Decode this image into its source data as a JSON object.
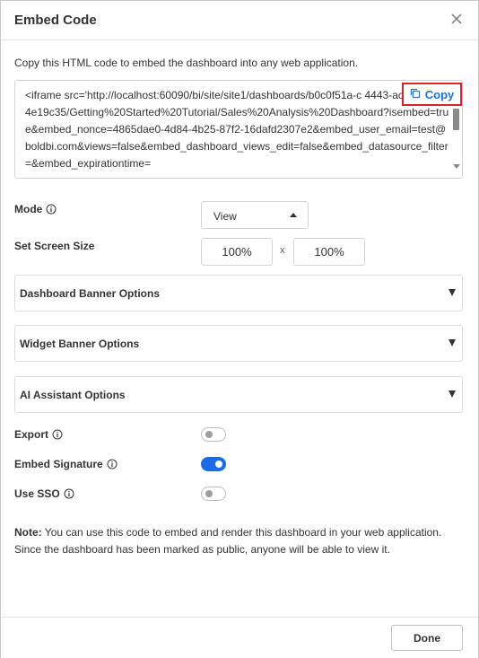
{
  "dialog": {
    "title": "Embed Code",
    "description": "Copy this HTML code to embed the dashboard into any web application.",
    "code": "<iframe src='http://localhost:60090/bi/site/site1/dashboards/b0c0f51a-c 4443-ac6c-874384e19c35/Getting%20Started%20Tutorial/Sales%20Analysis%20Dashboard?isembed=true&embed_nonce=4865dae0-4d84-4b25-87f2-16dafd2307e2&embed_user_email=test@boldbi.com&views=false&embed_dashboard_views_edit=false&embed_datasource_filter=&embed_expirationtime=",
    "copy_label": "Copy"
  },
  "mode": {
    "label": "Mode",
    "value": "View"
  },
  "screen_size": {
    "label": "Set Screen Size",
    "width": "100%",
    "separator": "x",
    "height": "100%"
  },
  "accordions": [
    {
      "label": "Dashboard Banner Options"
    },
    {
      "label": "Widget Banner Options"
    },
    {
      "label": "AI Assistant Options"
    }
  ],
  "toggles": {
    "export": {
      "label": "Export",
      "state": "off"
    },
    "embed_signature": {
      "label": "Embed Signature",
      "state": "on"
    },
    "use_sso": {
      "label": "Use SSO",
      "state": "off"
    }
  },
  "note": {
    "prefix": "Note:",
    "text": " You can use this code to embed and render this dashboard in your web application. Since the dashboard has been marked as public, anyone will be able to view it."
  },
  "footer": {
    "done_label": "Done"
  },
  "colors": {
    "accent": "#1a6ce6",
    "copy_highlight": "#e0202a"
  }
}
